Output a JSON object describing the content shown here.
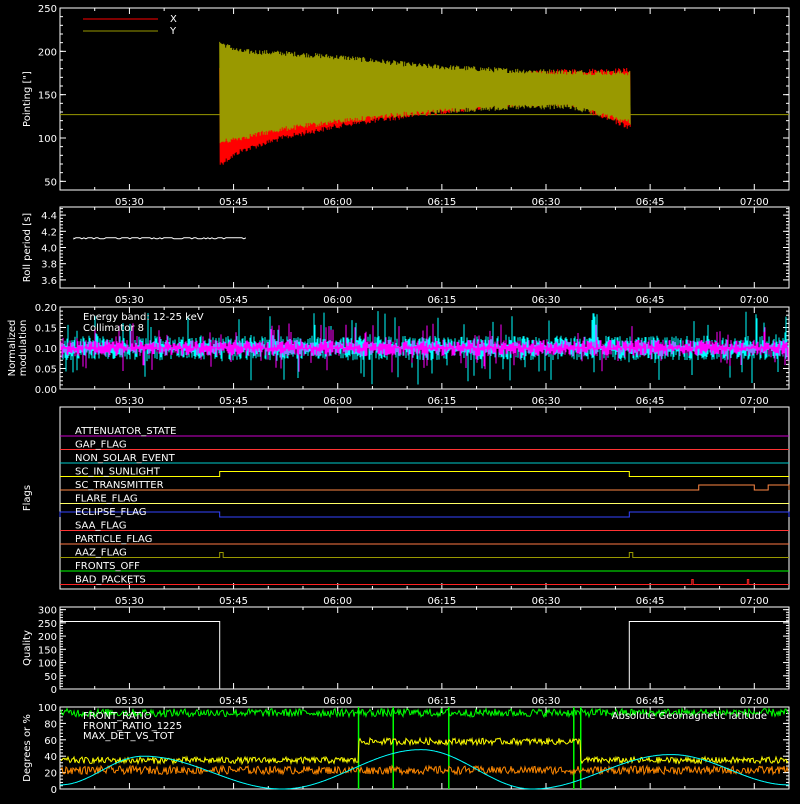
{
  "chart_data": [
    {
      "id": "pointing",
      "type": "line",
      "ylabel": "Pointing [\"]",
      "ylim": [
        40,
        250
      ],
      "yticks": [
        50,
        100,
        150,
        200,
        250
      ],
      "xlim": [
        "05:20",
        "07:05"
      ],
      "xticks": [
        "05:30",
        "05:45",
        "06:00",
        "06:15",
        "06:30",
        "06:45",
        "07:00"
      ],
      "legend": [
        {
          "name": "X",
          "color": "#ff0000"
        },
        {
          "name": "Y",
          "color": "#999900"
        }
      ],
      "series": [
        {
          "name": "X",
          "color": "#ff0000",
          "segments": [
            {
              "t_start": "05:43",
              "t_end": "06:42",
              "upper": [
                [
                  0,
                  180
                ],
                [
                  0.05,
                  178
                ],
                [
                  0.15,
                  175
                ],
                [
                  0.3,
                  172
                ],
                [
                  0.5,
                  170
                ],
                [
                  0.7,
                  173
                ],
                [
                  0.85,
                  177
                ],
                [
                  1,
                  178
                ]
              ],
              "lower": [
                [
                  0,
                  70
                ],
                [
                  0.05,
                  85
                ],
                [
                  0.15,
                  100
                ],
                [
                  0.3,
                  115
                ],
                [
                  0.5,
                  128
                ],
                [
                  0.7,
                  138
                ],
                [
                  0.85,
                  140
                ],
                [
                  1,
                  112
                ]
              ]
            }
          ]
        },
        {
          "name": "Y",
          "color": "#999900",
          "segments": [
            {
              "t_start": "05:43",
              "t_end": "06:42",
              "upper": [
                [
                  0,
                  210
                ],
                [
                  0.05,
                  200
                ],
                [
                  0.15,
                  198
                ],
                [
                  0.3,
                  193
                ],
                [
                  0.5,
                  183
                ],
                [
                  0.7,
                  178
                ],
                [
                  0.85,
                  176
                ],
                [
                  1,
                  175
                ]
              ],
              "lower": [
                [
                  0,
                  95
                ],
                [
                  0.05,
                  100
                ],
                [
                  0.15,
                  110
                ],
                [
                  0.3,
                  120
                ],
                [
                  0.5,
                  130
                ],
                [
                  0.7,
                  135
                ],
                [
                  0.85,
                  136
                ],
                [
                  1,
                  118
                ]
              ]
            }
          ]
        }
      ],
      "baseline": {
        "value": 127,
        "color": "#999900"
      }
    },
    {
      "id": "roll",
      "type": "line",
      "ylabel": "Roll period [s]",
      "ylim": [
        3.5,
        4.5
      ],
      "yticks": [
        "3.6",
        "3.8",
        "4.0",
        "4.2",
        "4.4"
      ],
      "xlim": [
        "05:20",
        "07:05"
      ],
      "xticks": [
        "05:30",
        "05:45",
        "06:00",
        "06:15",
        "06:30",
        "06:45",
        "07:00"
      ],
      "series": [
        {
          "name": "",
          "color": "#ffffff",
          "x": [
            "05:20",
            "05:47",
            "07:05"
          ],
          "y": [
            4.12,
            4.11,
            4.11
          ]
        }
      ]
    },
    {
      "id": "modulation",
      "type": "line",
      "ylabel": "Normalized modulation",
      "ylabel_lines": [
        "Normalized",
        "modulation"
      ],
      "ylim": [
        0,
        0.2
      ],
      "yticks": [
        "0.00",
        "0.05",
        "0.10",
        "0.15",
        "0.20"
      ],
      "xlim": [
        "05:20",
        "07:05"
      ],
      "xticks": [
        "05:30",
        "05:45",
        "06:00",
        "06:15",
        "06:30",
        "06:45",
        "07:00"
      ],
      "annotations": [
        "Energy band: 12-25 keV",
        "Collimator 8"
      ],
      "series": [
        {
          "name": "Collimator 8",
          "color": "#00ffff",
          "mean": 0.1,
          "spread": 0.03
        },
        {
          "name": "",
          "color": "#ff00ff",
          "mean": 0.1,
          "spread": 0.02
        }
      ]
    },
    {
      "id": "flags",
      "type": "line",
      "ylabel": "Flags",
      "xlim": [
        "05:20",
        "07:05"
      ],
      "xticks": [
        "05:30",
        "05:45",
        "06:00",
        "06:15",
        "06:30",
        "06:45",
        "07:00"
      ],
      "flags": [
        {
          "name": "ATTENUATOR_STATE",
          "color": "#cc00cc",
          "steps": []
        },
        {
          "name": "GAP_FLAG",
          "color": "#ff3333",
          "steps": []
        },
        {
          "name": "NON_SOLAR_EVENT",
          "color": "#00cccc",
          "steps": []
        },
        {
          "name": "SC_IN_SUNLIGHT",
          "color": "#ffff00",
          "steps": [
            [
              "05:43",
              "06:42"
            ]
          ]
        },
        {
          "name": "SC_TRANSMITTER",
          "color": "#ff8844",
          "steps": [
            [
              "06:52",
              "07:00"
            ],
            [
              "07:02",
              "07:05"
            ]
          ]
        },
        {
          "name": "FLARE_FLAG",
          "color": "#ffff66",
          "steps": []
        },
        {
          "name": "ECLIPSE_FLAG",
          "color": "#3344ff",
          "steps": [
            [
              "05:20",
              "05:43"
            ],
            [
              "06:42",
              "07:05"
            ]
          ]
        },
        {
          "name": "SAA_FLAG",
          "color": "#ff3333",
          "steps": []
        },
        {
          "name": "PARTICLE_FLAG",
          "color": "#ff7744",
          "steps": []
        },
        {
          "name": "AAZ_FLAG",
          "color": "#999900",
          "steps": [
            [
              "05:43",
              "05:43.5"
            ],
            [
              "06:42",
              "06:42.5"
            ]
          ]
        },
        {
          "name": "FRONTS_OFF",
          "color": "#00ff00",
          "steps": []
        },
        {
          "name": "BAD_PACKETS",
          "color": "#ff2222",
          "steps": [
            [
              "06:51",
              "06:51.2"
            ],
            [
              "06:59",
              "06:59.2"
            ]
          ]
        }
      ]
    },
    {
      "id": "quality",
      "type": "line",
      "ylabel": "Quality",
      "ylim": [
        0,
        310
      ],
      "yticks": [
        "0",
        "50",
        "100",
        "150",
        "200",
        "250",
        "300"
      ],
      "xlim": [
        "05:20",
        "07:05"
      ],
      "xticks": [
        "05:30",
        "05:45",
        "06:00",
        "06:15",
        "06:30",
        "06:45",
        "07:00"
      ],
      "series": [
        {
          "name": "",
          "color": "#ffffff",
          "x": [
            "05:20",
            "05:43",
            "05:43",
            "06:42",
            "06:42",
            "07:05"
          ],
          "y": [
            255,
            255,
            0,
            0,
            255,
            255
          ]
        }
      ]
    },
    {
      "id": "ratios",
      "type": "line",
      "ylabel": "Degrees or %",
      "ylim": [
        0,
        100
      ],
      "yticks": [
        "0",
        "20",
        "40",
        "60",
        "80",
        "100"
      ],
      "xlim": [
        "05:20",
        "07:05"
      ],
      "legend": [
        {
          "name": "FRONT_RATIO",
          "color": "#00ff00"
        },
        {
          "name": "FRONT_RATIO_1225",
          "color": "#ffff00"
        },
        {
          "name": "MAX_DET_VS_TOT",
          "color": "#ff8800"
        }
      ],
      "right_label": {
        "text": "Absolute Geomagnetic latitude",
        "color": "#00ffff"
      },
      "vlines": [
        "06:03",
        "06:08",
        "06:16",
        "06:34",
        "06:35"
      ],
      "series": [
        {
          "name": "FRONT_RATIO",
          "color": "#00ff00",
          "mean": 93,
          "spread": 5
        },
        {
          "name": "FRONT_RATIO_1225",
          "color": "#ffff00",
          "mean": 35,
          "spread": 4,
          "plateau": {
            "from": "06:03",
            "to": "06:35",
            "value": 58
          }
        },
        {
          "name": "MAX_DET_VS_TOT",
          "color": "#ff8800",
          "mean": 23,
          "spread": 5
        },
        {
          "name": "Absolute Geomagnetic latitude",
          "color": "#00ffff",
          "x": [
            "05:20",
            "05:32",
            "05:52",
            "06:12",
            "06:28",
            "06:48",
            "07:05"
          ],
          "y": [
            5,
            40,
            0,
            48,
            0,
            42,
            5
          ]
        }
      ]
    }
  ]
}
